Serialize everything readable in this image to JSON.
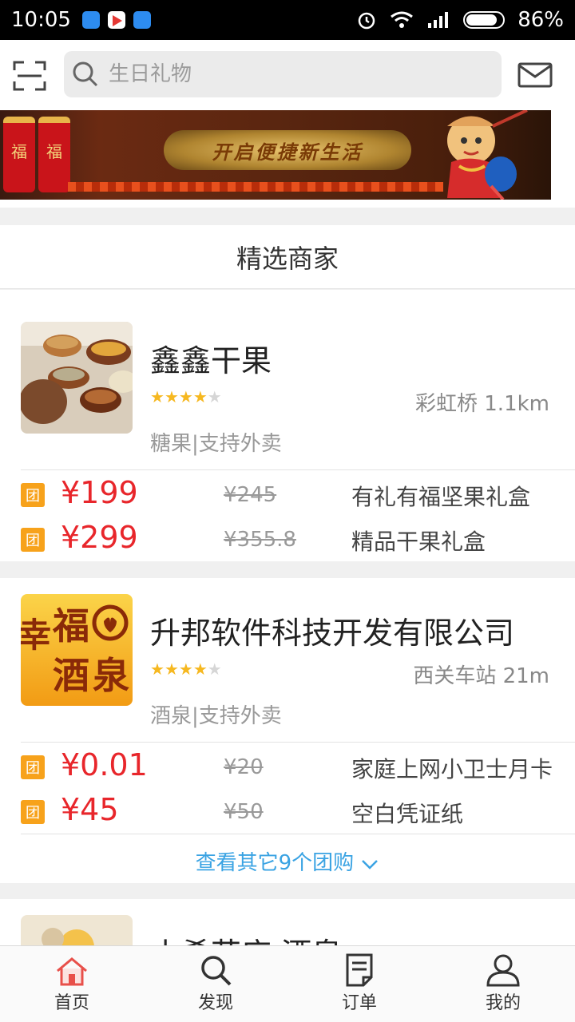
{
  "status_bar": {
    "time": "10:05",
    "battery": "86%",
    "battery_level": 0.86
  },
  "search": {
    "placeholder": "生日礼物"
  },
  "banner": {
    "text": "开启便捷新生活",
    "firecracker_char": "福"
  },
  "section_title": "精选商家",
  "merchants": [
    {
      "name": "鑫鑫干果",
      "rating": 4,
      "location": "彩虹桥 1.1km",
      "tags": "糖果|支持外卖",
      "deals": [
        {
          "badge": "团",
          "price": "¥199",
          "original": "¥245",
          "title": "有礼有福坚果礼盒"
        },
        {
          "badge": "团",
          "price": "¥299",
          "original": "¥355.8",
          "title": "精品干果礼盒"
        }
      ]
    },
    {
      "name": "升邦软件科技开发有限公司",
      "rating": 4,
      "location": "西关车站 21m",
      "tags": "酒泉|支持外卖",
      "thumb_text": [
        "幸",
        "福",
        "酒",
        "泉"
      ],
      "deals": [
        {
          "badge": "团",
          "price": "¥0.01",
          "original": "¥20",
          "title": "家庭上网小卫士月卡"
        },
        {
          "badge": "团",
          "price": "¥45",
          "original": "¥50",
          "title": "空白凭证纸"
        }
      ],
      "more_link": "查看其它9个团购"
    },
    {
      "name": "小希花店 酒泉"
    }
  ],
  "tabs": [
    {
      "label": "首页",
      "icon": "home-icon",
      "active": true
    },
    {
      "label": "发现",
      "icon": "search-icon"
    },
    {
      "label": "订单",
      "icon": "order-icon"
    },
    {
      "label": "我的",
      "icon": "user-icon"
    }
  ],
  "colors": {
    "price": "#e8262b",
    "badge": "#f7a21b",
    "link": "#3aa3e3",
    "star": "#f6b820",
    "home_active": "#e8504a"
  }
}
